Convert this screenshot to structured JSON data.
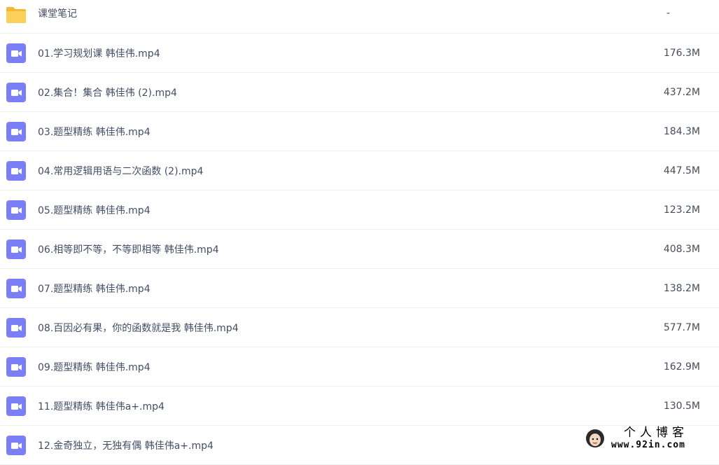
{
  "files": [
    {
      "name": "课堂笔记",
      "size": "-",
      "icon": "folder-icon"
    },
    {
      "name": "01.学习规划课 韩佳伟.mp4",
      "size": "176.3M",
      "icon": "video-file-icon"
    },
    {
      "name": "02.集合！集合 韩佳伟 (2).mp4",
      "size": "437.2M",
      "icon": "video-file-icon"
    },
    {
      "name": "03.题型精练 韩佳伟.mp4",
      "size": "184.3M",
      "icon": "video-file-icon"
    },
    {
      "name": "04.常用逻辑用语与二次函数 (2).mp4",
      "size": "447.5M",
      "icon": "video-file-icon"
    },
    {
      "name": "05.题型精练 韩佳伟.mp4",
      "size": "123.2M",
      "icon": "video-file-icon"
    },
    {
      "name": "06.相等即不等，不等即相等 韩佳伟.mp4",
      "size": "408.3M",
      "icon": "video-file-icon"
    },
    {
      "name": "07.题型精练 韩佳伟.mp4",
      "size": "138.2M",
      "icon": "video-file-icon"
    },
    {
      "name": "08.百因必有果，你的函数就是我 韩佳伟.mp4",
      "size": "577.7M",
      "icon": "video-file-icon"
    },
    {
      "name": "09.题型精练 韩佳伟.mp4",
      "size": "162.9M",
      "icon": "video-file-icon"
    },
    {
      "name": "11.题型精练 韩佳伟a+.mp4",
      "size": "130.5M",
      "icon": "video-file-icon"
    },
    {
      "name": "12.金奇独立，无独有偶 韩佳伟a+.mp4",
      "size": "",
      "icon": "video-file-icon"
    }
  ],
  "watermark": {
    "title": "个人博客",
    "url": "www.92in.com"
  },
  "colors": {
    "folder": "#f9c84e",
    "video": "#7b7ff5",
    "text": "#424e67",
    "divider": "#eef0f4"
  }
}
